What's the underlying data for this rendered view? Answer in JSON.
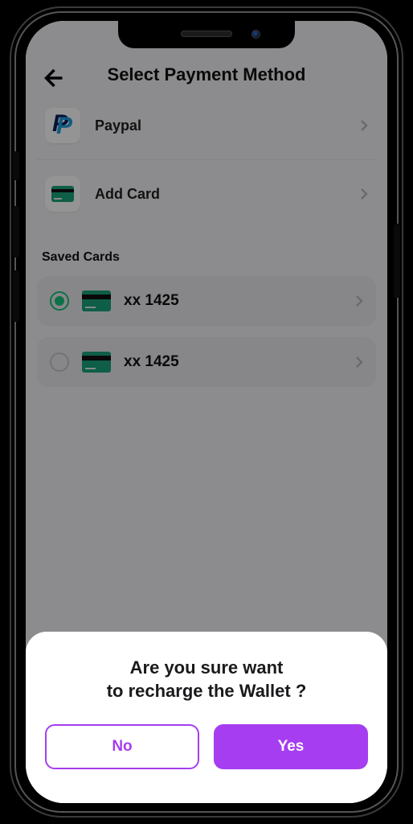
{
  "header": {
    "title": "Select Payment Method"
  },
  "methods": [
    {
      "label": "Paypal"
    },
    {
      "label": "Add Card"
    }
  ],
  "saved": {
    "heading": "Saved Cards",
    "cards": [
      {
        "label": "xx 1425",
        "selected": true
      },
      {
        "label": "xx 1425",
        "selected": false
      }
    ]
  },
  "dialog": {
    "message": "Are you sure want\nto recharge the Wallet ?",
    "no_label": "No",
    "yes_label": "Yes"
  },
  "colors": {
    "accent": "#a63df0",
    "radio_selected": "#17c17a",
    "card_icon": "#1aa27a"
  }
}
